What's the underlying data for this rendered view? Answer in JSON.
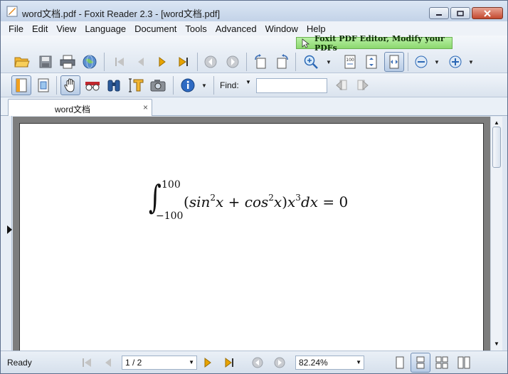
{
  "window": {
    "title": "word文档.pdf - Foxit Reader 2.3 - [word文档.pdf]"
  },
  "menu": [
    "File",
    "Edit",
    "View",
    "Language",
    "Document",
    "Tools",
    "Advanced",
    "Window",
    "Help"
  ],
  "promo": {
    "label": "Foxit PDF Editor, Modify your PDFs"
  },
  "find": {
    "label": "Find:",
    "value": ""
  },
  "tab": {
    "label": "word文档",
    "close": "×"
  },
  "document": {
    "equation": {
      "upper_limit": "100",
      "lower_limit": "−100",
      "integral_sign": "∫"
    }
  },
  "status": {
    "text": "Ready",
    "page": "1 / 2",
    "zoom": "82.24%"
  },
  "colors": {
    "promo_bg": "#8cd86e",
    "window_frame": "#dfe7f2",
    "nav_arrow": "#e8a400"
  }
}
